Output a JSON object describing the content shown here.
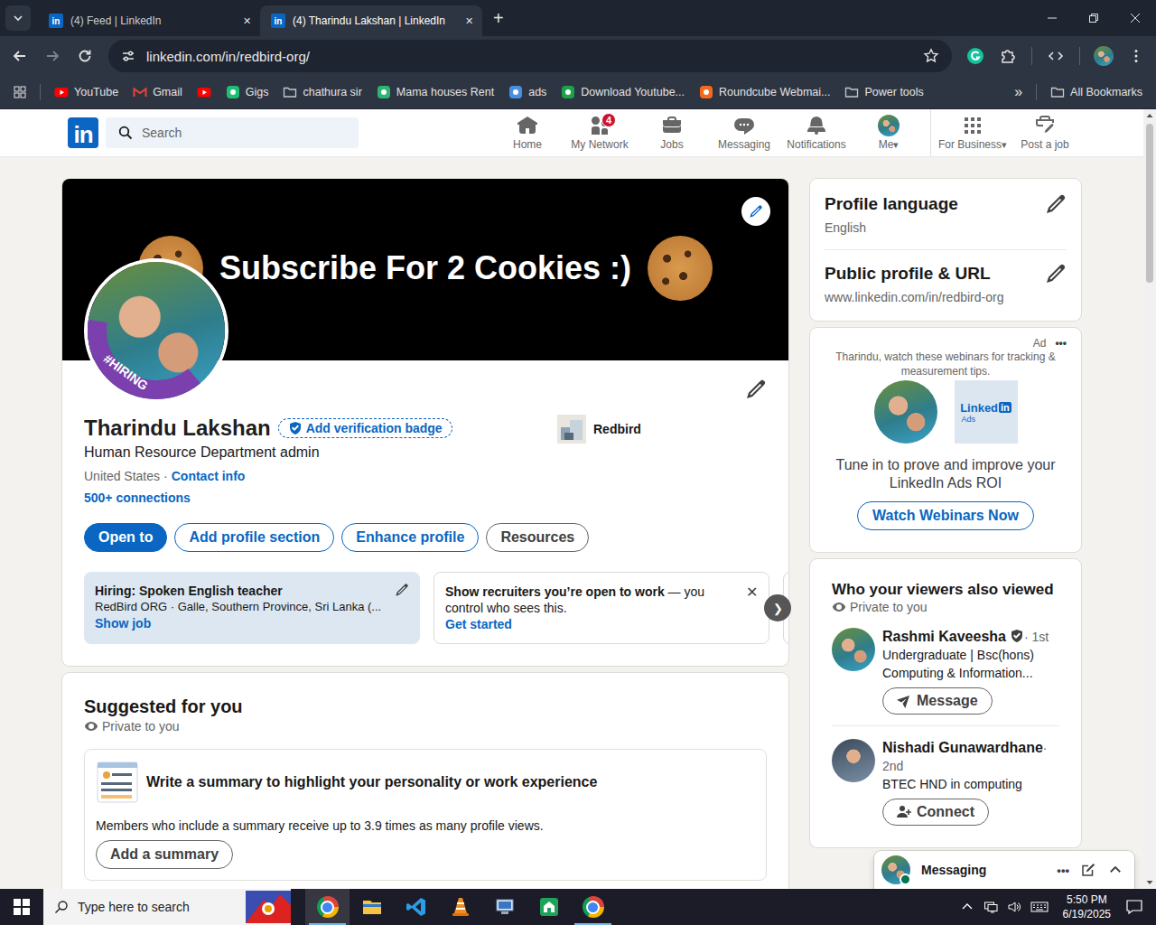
{
  "browser": {
    "tabs": [
      {
        "label": "(4) Feed | LinkedIn",
        "selected": false,
        "close": "✕"
      },
      {
        "label": "(4) Tharindu Lakshan | LinkedIn",
        "selected": true,
        "close": "✕"
      }
    ],
    "new_tab": "+",
    "url": "linkedin.com/in/redbird-org/",
    "bookmarks": [
      {
        "label": "YouTube",
        "kind": "video",
        "color": "#ff0000"
      },
      {
        "label": "Gmail",
        "kind": "mail",
        "color": "#ea4335"
      },
      {
        "kind": "video",
        "color": "#ff0000"
      },
      {
        "label": "Gigs",
        "kind": "site",
        "color": "#1dbf73"
      },
      {
        "label": "chathura sir",
        "kind": "folder",
        "color": "#c7c7c7"
      },
      {
        "label": "Mama houses Rent",
        "kind": "site",
        "color": "#2bb673"
      },
      {
        "label": "ads",
        "kind": "site",
        "color": "#4a90e2"
      },
      {
        "label": "Download Youtube...",
        "kind": "site",
        "color": "#1aa34a"
      },
      {
        "label": "Roundcube Webmai...",
        "kind": "site",
        "color": "#f26b1d"
      },
      {
        "label": "Power tools",
        "kind": "folder",
        "color": "#c7c7c7"
      }
    ],
    "bookmarks_overflow": "»",
    "all_bookmarks": "All Bookmarks"
  },
  "linkedin": {
    "logo": "in",
    "search_placeholder": "Search",
    "nav": [
      {
        "label": "Home",
        "kind": "icon"
      },
      {
        "label": "My Network",
        "kind": "icon",
        "badge": "4"
      },
      {
        "label": "Jobs",
        "kind": "icon"
      },
      {
        "label": "Messaging",
        "kind": "icon"
      },
      {
        "label": "Notifications",
        "kind": "icon"
      },
      {
        "label": "Me",
        "kind": "avatar",
        "caret": "▾"
      },
      {
        "label": "For Business",
        "kind": "icon",
        "caret": "▾"
      },
      {
        "label": "Post a job",
        "kind": "icon"
      }
    ]
  },
  "profile": {
    "banner_text": "Subscribe For 2 Cookies :)",
    "frame_text": "#HIRING",
    "name": "Tharindu Lakshan",
    "verify": "Add verification badge",
    "headline": "Human Resource Department admin",
    "location": "United States",
    "separator": "·",
    "contact": "Contact info",
    "connections": "500+ connections",
    "company": "Redbird",
    "actions": [
      {
        "label": "Open to",
        "kind": "primary"
      },
      {
        "label": "Add profile section",
        "kind": "outline"
      },
      {
        "label": "Enhance profile",
        "kind": "outline"
      },
      {
        "label": "Resources",
        "kind": "neutral"
      }
    ],
    "cards": [
      {
        "kind": "job",
        "title": "Hiring: Spoken English teacher",
        "subtitle": "RedBird ORG · Galle, Southern Province, Sri Lanka (...",
        "link": "Show job"
      },
      {
        "kind": "prompt",
        "title": "Show recruiters you’re open to work",
        "text": " — you control who sees this.",
        "link": "Get started",
        "close": "✕"
      }
    ],
    "next": "❯"
  },
  "suggested": {
    "title": "Suggested for you",
    "privacy": "Private to you",
    "item": {
      "title": "Write a summary to highlight your personality or work experience",
      "text": "Members who include a summary receive up to 3.9 times as many profile views.",
      "button": "Add a summary"
    }
  },
  "sidebar": {
    "settings": [
      {
        "title": "Profile language",
        "value": "English"
      },
      {
        "title": "Public profile & URL",
        "value": "www.linkedin.com/in/redbird-org"
      }
    ],
    "ad": {
      "label": "Ad",
      "more": "•••",
      "text": "Tharindu, watch these webinars for tracking & measurement tips.",
      "logo_text": "Linked",
      "logo_in": "in",
      "logo_sub": "Ads",
      "tagline": "Tune in to prove and improve your LinkedIn Ads ROI",
      "button": "Watch Webinars Now"
    },
    "viewers": {
      "title": "Who your viewers also viewed",
      "privacy": "Private to you",
      "people": [
        {
          "name": "Rashmi Kaveesha",
          "verified": true,
          "degree": "· 1st",
          "lines": [
            "Undergraduate | Bsc(hons)",
            "Computing & Information..."
          ],
          "action": "Message",
          "kind": "message"
        },
        {
          "name": "Nishadi Gunawardhane",
          "verified": false,
          "degree": "· 2nd",
          "lines": [
            "BTEC HND in computing"
          ],
          "action": "Connect",
          "kind": "connect"
        }
      ]
    }
  },
  "messaging": {
    "label": "Messaging",
    "more": "•••",
    "online": true
  },
  "taskbar": {
    "search": "Type here to search",
    "apps": [
      {
        "kind": "chrome",
        "running": true,
        "selected": true
      },
      {
        "kind": "explorer",
        "running": false,
        "selected": false
      },
      {
        "kind": "vscode",
        "running": false,
        "selected": false
      },
      {
        "kind": "vlc",
        "running": false,
        "selected": false
      },
      {
        "kind": "netapp",
        "running": false,
        "selected": false
      },
      {
        "kind": "store",
        "running": false,
        "selected": false
      },
      {
        "kind": "chrome",
        "running": true,
        "selected": false
      }
    ],
    "time": "5:50 PM",
    "date": "6/19/2025"
  }
}
